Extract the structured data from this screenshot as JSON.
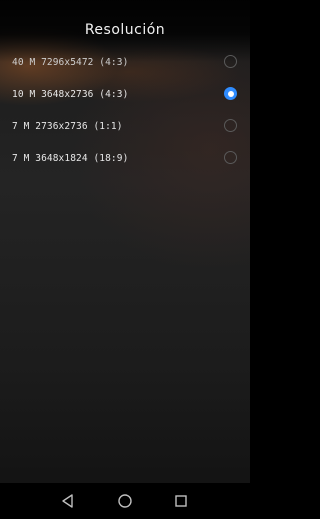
{
  "header": {
    "title": "Resolución"
  },
  "resolutions": [
    {
      "label": "40 M 7296x5472 (4:3)",
      "selected": false
    },
    {
      "label": "10 M 3648x2736 (4:3)",
      "selected": true
    },
    {
      "label": "7 M 2736x2736 (1:1)",
      "selected": false
    },
    {
      "label": "7 M 3648x1824 (18:9)",
      "selected": false
    }
  ],
  "colors": {
    "accent": "#2f8cff",
    "radio_off": "#5a5a5a"
  },
  "navbar": {
    "back_icon": "triangle-back-icon",
    "home_icon": "circle-home-icon",
    "recent_icon": "square-recents-icon"
  }
}
